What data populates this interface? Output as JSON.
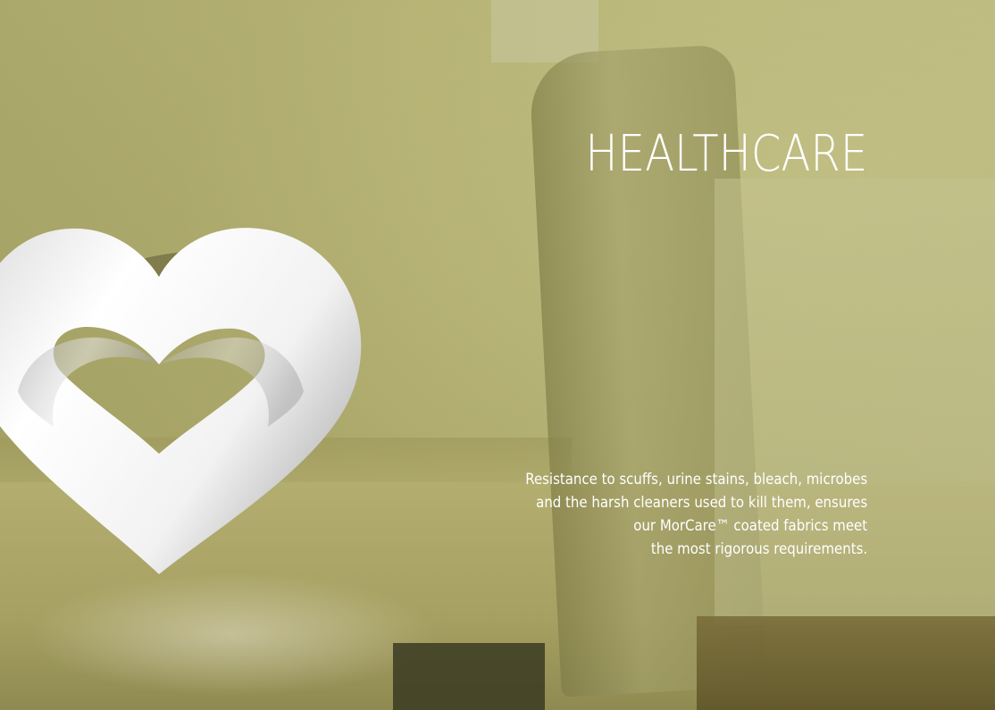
{
  "hero": {
    "title": "HEALTHCARE",
    "body_lines": [
      "Resistance to scuffs, urine stains, bleach, microbes",
      "and the harsh cleaners used to kill them, ensures",
      "our MorCare™ coated fabrics meet",
      "the most rigorous requirements."
    ],
    "heart_icon": "heart-icon"
  },
  "colors": {
    "overlay": "#b2ae6d",
    "text": "#ffffff",
    "heart": "#ffffff"
  }
}
